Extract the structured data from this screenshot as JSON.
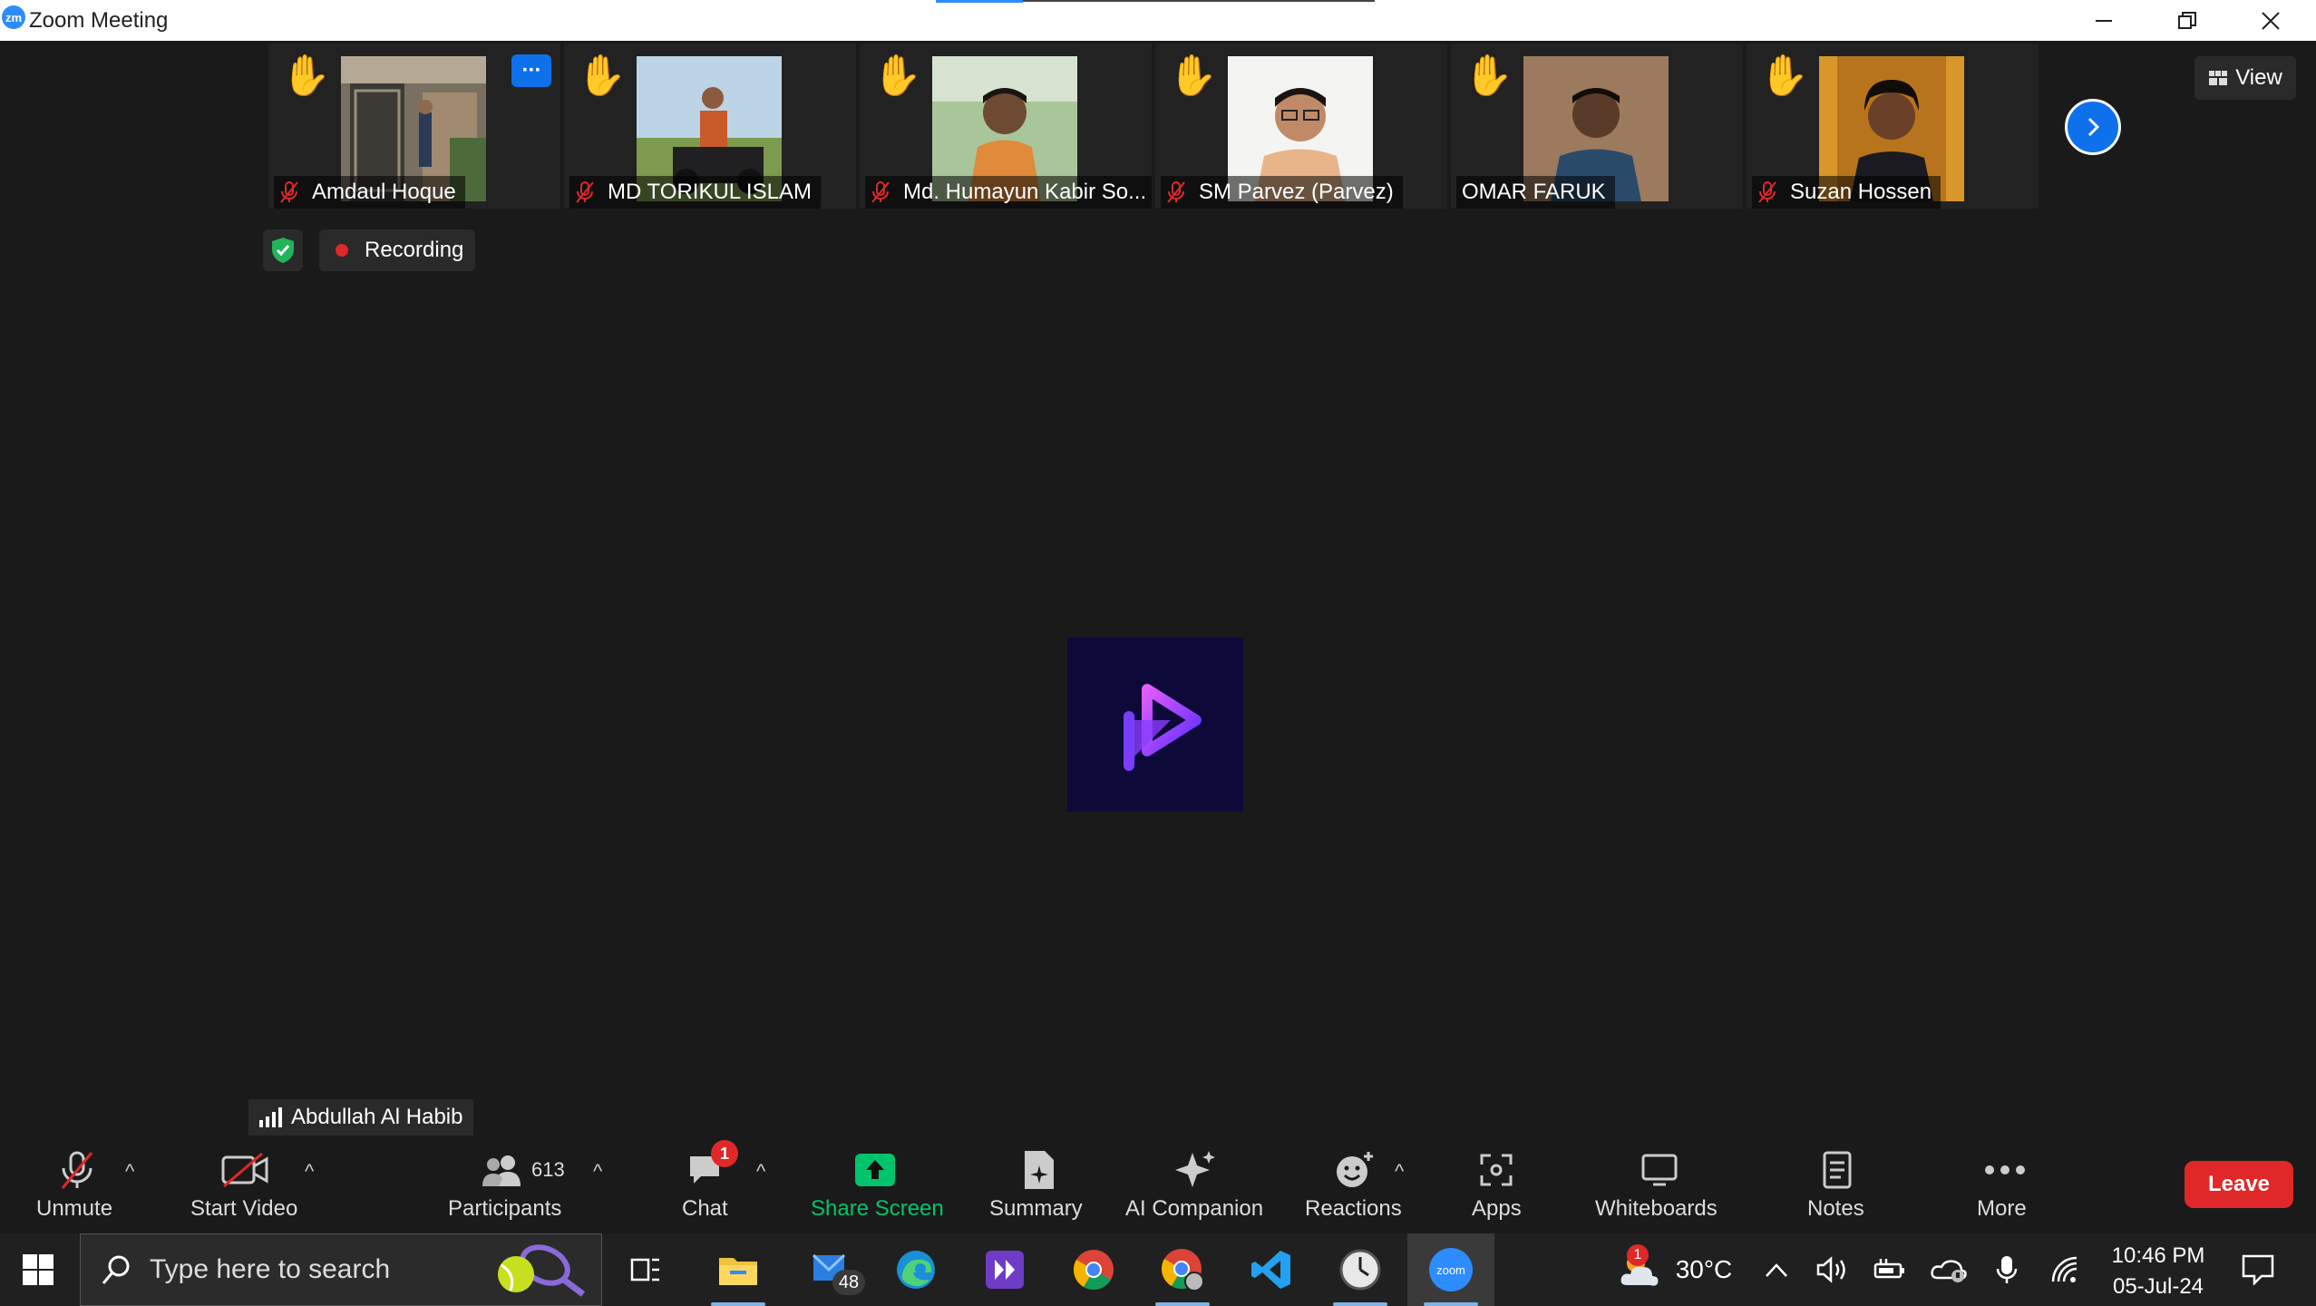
{
  "window": {
    "app_icon": "zm",
    "title": "Zoom Meeting"
  },
  "gallery": {
    "participants": [
      {
        "name": "Amdaul Hoque",
        "muted": true,
        "hand_raised": true
      },
      {
        "name": "MD TORIKUL ISLAM",
        "muted": true,
        "hand_raised": true
      },
      {
        "name": "Md. Humayun Kabir So...",
        "muted": true,
        "hand_raised": true
      },
      {
        "name": "SM Parvez (Parvez)",
        "muted": true,
        "hand_raised": true
      },
      {
        "name": "OMAR FARUK",
        "muted": false,
        "hand_raised": true
      },
      {
        "name": "Suzan Hossen",
        "muted": true,
        "hand_raised": true
      }
    ],
    "more_dots": "···",
    "view_label": "View"
  },
  "status": {
    "recording_label": "Recording"
  },
  "active_speaker": {
    "name": "Abdullah Al Habib"
  },
  "toolbar": {
    "unmute": "Unmute",
    "start_video": "Start Video",
    "participants": "Participants",
    "participants_count": "613",
    "chat": "Chat",
    "chat_badge": "1",
    "share_screen": "Share Screen",
    "summary": "Summary",
    "ai_companion": "AI Companion",
    "reactions": "Reactions",
    "apps": "Apps",
    "whiteboards": "Whiteboards",
    "notes": "Notes",
    "more": "More",
    "leave": "Leave"
  },
  "taskbar": {
    "search_placeholder": "Type here to search",
    "mail_badge": "48",
    "zoom_label": "zoom",
    "weather_badge": "1",
    "temperature": "30°C",
    "time": "10:46 PM",
    "date": "05-Jul-24"
  },
  "colors": {
    "accent_blue": "#0e71eb",
    "share_green": "#00c46b",
    "leave_red": "#e02828",
    "hand_yellow": "#f2b51d"
  }
}
